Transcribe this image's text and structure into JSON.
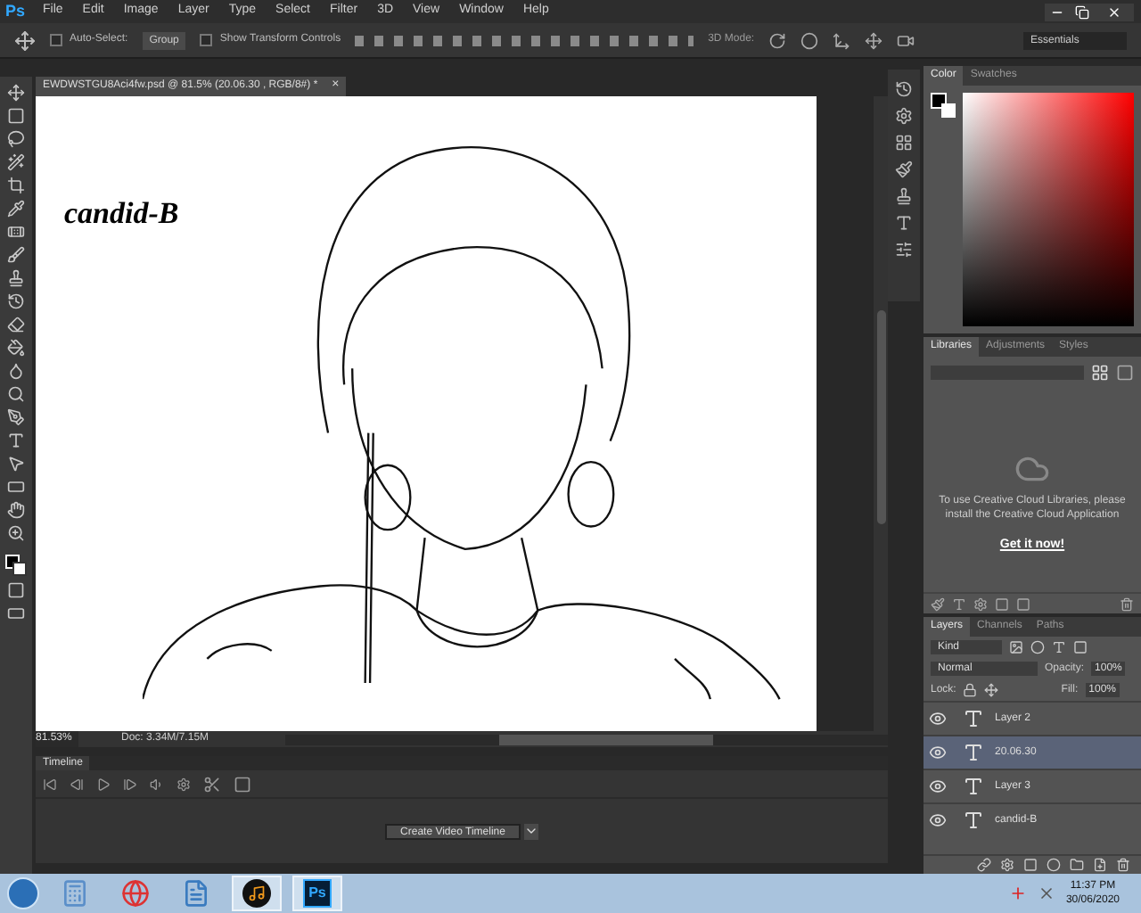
{
  "app_logo": "Ps",
  "menu": [
    "File",
    "Edit",
    "Image",
    "Layer",
    "Type",
    "Select",
    "Filter",
    "3D",
    "View",
    "Window",
    "Help"
  ],
  "options_bar": {
    "auto_select": {
      "label": "Auto-Select:",
      "checked": false
    },
    "target": "Group",
    "transform": {
      "label": "Show Transform Controls",
      "checked": false
    },
    "mode_3d": "3D Mode:",
    "workspace": "Essentials"
  },
  "document_tab": {
    "title": "EWDWSTGU8Aci4fw.psd @ 81.5% (20.06.30 , RGB/8#) *",
    "close": "×"
  },
  "canvas": {
    "text": "candid-B"
  },
  "status": {
    "zoom": "81.53%",
    "doc": "Doc: 3.34M/7.15M"
  },
  "color_panel": {
    "tabs": [
      {
        "label": "Color",
        "selected": true
      },
      {
        "label": "Swatches",
        "selected": false
      }
    ]
  },
  "libraries_panel": {
    "tabs": [
      {
        "label": "Libraries",
        "selected": true
      },
      {
        "label": "Adjustments",
        "selected": false
      },
      {
        "label": "Styles",
        "selected": false
      }
    ],
    "message": "To use Creative Cloud Libraries, please install the Creative Cloud Application",
    "link": "Get it now!"
  },
  "layers_panel": {
    "tabs": [
      {
        "label": "Layers",
        "selected": true
      },
      {
        "label": "Channels",
        "selected": false
      },
      {
        "label": "Paths",
        "selected": false
      }
    ],
    "filter": "Kind",
    "blend_mode": "Normal",
    "opacity_label": "Opacity:",
    "opacity": "100%",
    "lock_label": "Lock:",
    "fill_label": "Fill:",
    "fill": "100%",
    "layers": [
      {
        "name": "Layer 2",
        "visible": true,
        "selected": false
      },
      {
        "name": "20.06.30",
        "visible": true,
        "selected": true
      },
      {
        "name": "Layer 3",
        "visible": true,
        "selected": false
      },
      {
        "name": "candid-B",
        "visible": true,
        "selected": false
      }
    ]
  },
  "timeline": {
    "title": "Timeline",
    "button": "Create Video Timeline"
  },
  "taskbar": {
    "apps": [
      {
        "kind": "calculator",
        "running": false
      },
      {
        "kind": "browser",
        "running": false
      },
      {
        "kind": "notes",
        "running": false
      },
      {
        "kind": "media",
        "running": true
      },
      {
        "kind": "photoshop",
        "running": true,
        "label": "Ps"
      }
    ],
    "time": "11:37 PM",
    "date": "30/06/2020"
  }
}
